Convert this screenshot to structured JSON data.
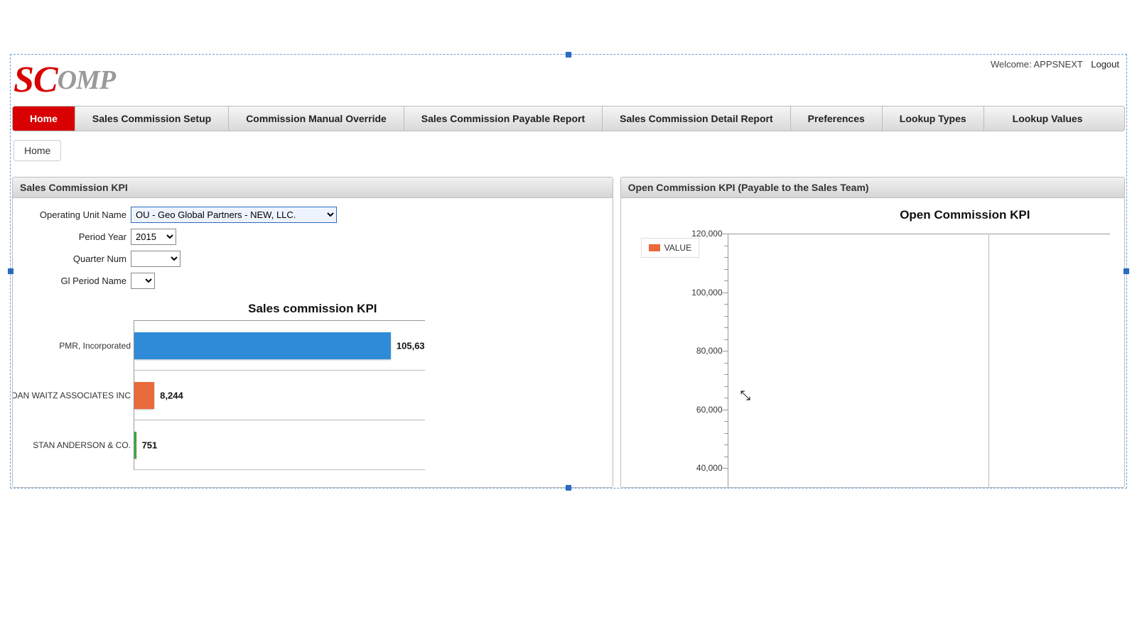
{
  "header": {
    "welcome_prefix": "Welcome:",
    "user": "APPSNEXT",
    "logout": "Logout",
    "logo_red": "SC",
    "logo_gray": "OMP"
  },
  "nav": [
    "Home",
    "Sales Commission Setup",
    "Commission Manual Override",
    "Sales Commission Payable Report",
    "Sales Commission Detail Report",
    "Preferences",
    "Lookup Types",
    "Lookup Values"
  ],
  "nav_active_index": 0,
  "breadcrumb": "Home",
  "left_panel": {
    "title": "Sales Commission KPI",
    "filters": {
      "ou_label": "Operating Unit Name",
      "ou_value": "OU - Geo Global Partners - NEW, LLC.",
      "year_label": "Period Year",
      "year_value": "2015",
      "quarter_label": "Quarter Num",
      "quarter_value": "",
      "gl_label": "Gl Period Name",
      "gl_value": ""
    }
  },
  "right_panel": {
    "title": "Open Commission KPI (Payable to the Sales Team)",
    "legend": "VALUE"
  },
  "chart_data": [
    {
      "type": "bar",
      "orientation": "horizontal",
      "title": "Sales commission KPI",
      "categories": [
        "PMR, Incorporated",
        "DAN WAITZ ASSOCIATES INC",
        "STAN ANDERSON & CO."
      ],
      "values": [
        105630,
        8244,
        751
      ],
      "value_labels": [
        "105,63",
        "8,244",
        "751"
      ],
      "colors": [
        "#2f8bd8",
        "#e96a3a",
        "#3aa742"
      ],
      "xmax": 120000
    },
    {
      "type": "bar",
      "title": "Open Commission KPI",
      "series": [
        {
          "name": "VALUE",
          "values": []
        }
      ],
      "categories": [],
      "ylim": [
        40000,
        120000
      ],
      "yticks": [
        120000,
        100000,
        80000,
        60000,
        40000
      ],
      "ytick_labels": [
        "120,000",
        "100,000",
        "80,000",
        "60,000",
        "40,000"
      ]
    }
  ]
}
